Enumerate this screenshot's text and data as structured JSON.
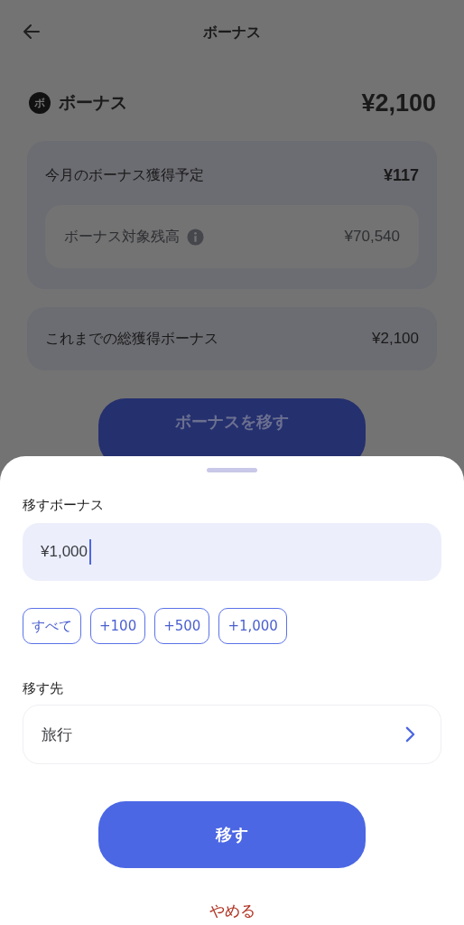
{
  "header": {
    "title": "ボーナス"
  },
  "summary": {
    "badge": "ボ",
    "label": "ボーナス",
    "amount": "¥2,100"
  },
  "monthly": {
    "label": "今月のボーナス獲得予定",
    "amount": "¥117",
    "eligible_label": "ボーナス対象残高",
    "eligible_amount": "¥70,540"
  },
  "total": {
    "label": "これまでの総獲得ボーナス",
    "amount": "¥2,100"
  },
  "move_button": "ボーナスを移す",
  "sheet": {
    "amount_label": "移すボーナス",
    "amount_value": "¥1,000",
    "chips": [
      {
        "label": "すべて"
      },
      {
        "label": "+100"
      },
      {
        "label": "+500"
      },
      {
        "label": "+1,000"
      }
    ],
    "destination_label": "移す先",
    "destination_value": "旅行",
    "submit": "移す",
    "cancel": "やめる"
  }
}
